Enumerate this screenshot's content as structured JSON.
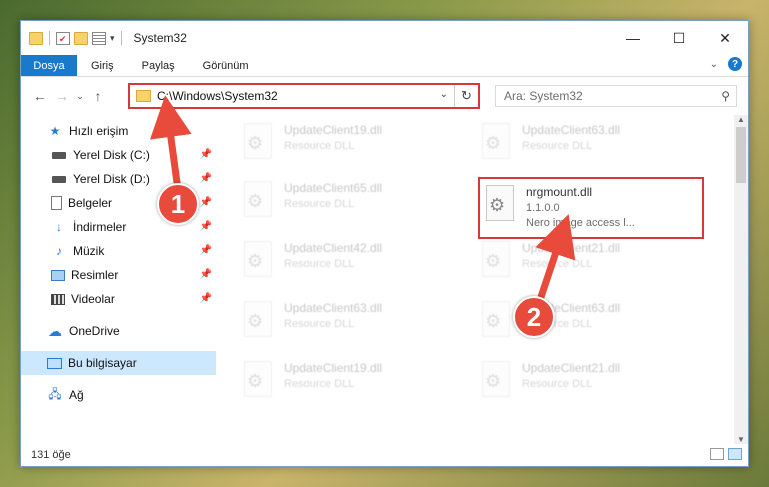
{
  "window": {
    "title": "System32",
    "controls": {
      "minimize": "—",
      "maximize": "☐",
      "close": "✕"
    }
  },
  "ribbon": {
    "tabs": [
      "Dosya",
      "Giriş",
      "Paylaş",
      "Görünüm"
    ]
  },
  "address": {
    "path": "C:\\Windows\\System32",
    "search_placeholder": "Ara: System32"
  },
  "sidebar": {
    "quick_access": "Hızlı erişim",
    "items": [
      {
        "label": "Yerel Disk (C:)",
        "icon": "disk-icon"
      },
      {
        "label": "Yerel Disk (D:)",
        "icon": "disk-icon"
      },
      {
        "label": "Belgeler",
        "icon": "documents-icon"
      },
      {
        "label": "İndirmeler",
        "icon": "download-icon"
      },
      {
        "label": "Müzik",
        "icon": "music-icon"
      },
      {
        "label": "Resimler",
        "icon": "pictures-icon"
      },
      {
        "label": "Videolar",
        "icon": "videos-icon"
      }
    ],
    "onedrive": "OneDrive",
    "this_pc": "Bu bilgisayar",
    "network": "Ağ"
  },
  "files": {
    "left": [
      {
        "name": "UpdateClient19.dll",
        "sub": "Resource DLL"
      },
      {
        "name": "UpdateClient65.dll",
        "sub": "Resource DLL"
      },
      {
        "name": "UpdateClient42.dll",
        "sub": "Resource DLL"
      },
      {
        "name": "UpdateClient63.dll",
        "sub": "Resource DLL"
      },
      {
        "name": "UpdateClient19.dll",
        "sub": "Resource DLL"
      }
    ],
    "right": [
      {
        "name": "UpdateClient63.dll",
        "sub": "Resource DLL"
      },
      {
        "name": "nrgmount.dll",
        "sub": "1.1.0.0",
        "sub2": "Nero image access l..."
      },
      {
        "name": "UpdateClient21.dll",
        "sub": "Resource DLL"
      },
      {
        "name": "UpdateClient63.dll",
        "sub": "Resource DLL"
      },
      {
        "name": "UpdateClient21.dll",
        "sub": "Resource DLL"
      }
    ]
  },
  "status": {
    "count": "131 öğe"
  },
  "annotations": {
    "marker1": "1",
    "marker2": "2",
    "color": "#e84a3b"
  }
}
